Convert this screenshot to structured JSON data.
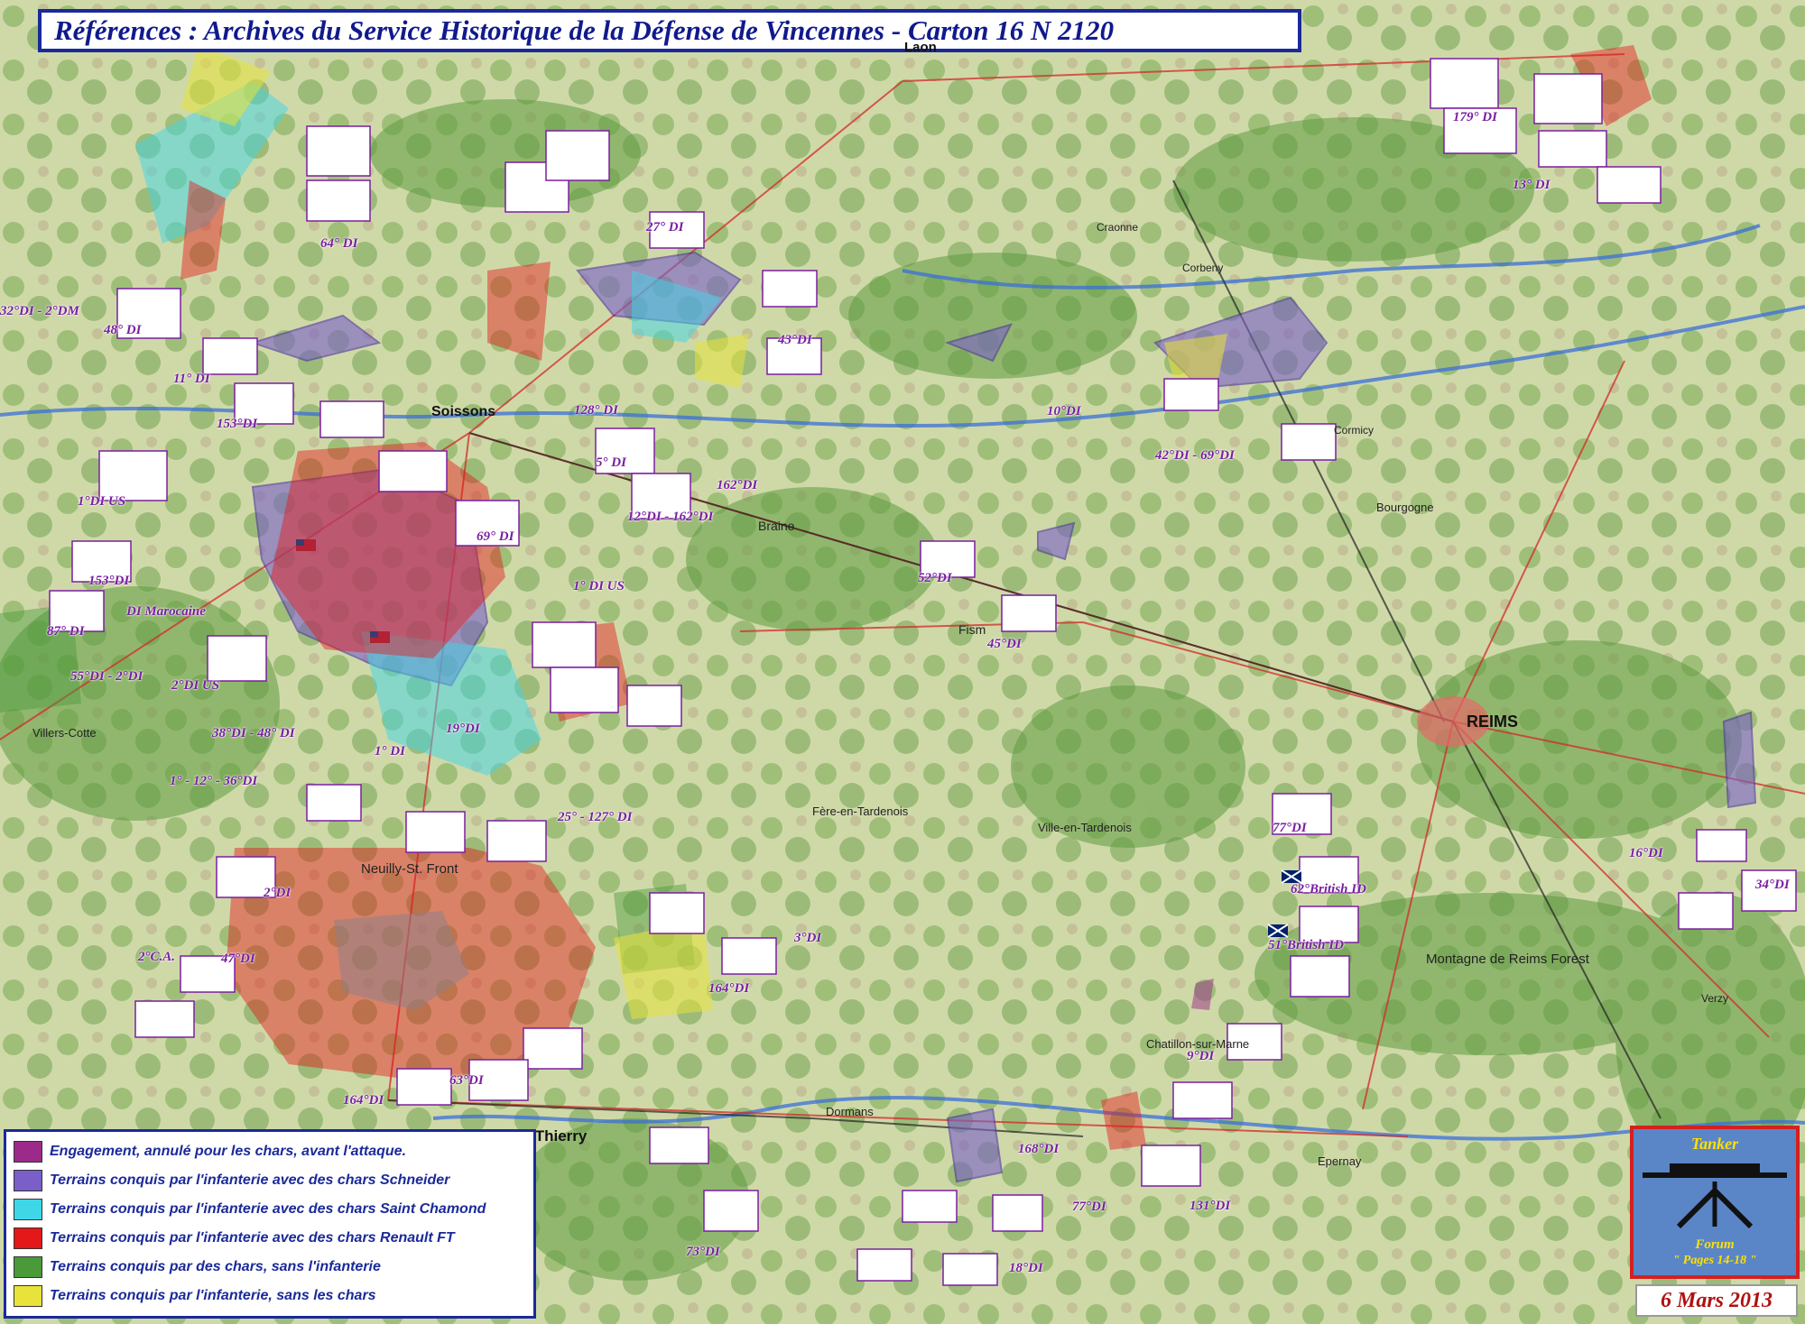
{
  "title": "Références : Archives du Service Historique de la Défense de Vincennes - Carton 16 N 2120",
  "legend": [
    {
      "color": "#9b2a8a",
      "text": "Engagement, annulé pour les chars, avant l'attaque."
    },
    {
      "color": "#7a5fc8",
      "text": "Terrains conquis par l'infanterie avec des chars Schneider"
    },
    {
      "color": "#3fd6e8",
      "text": "Terrains conquis par l'infanterie avec des chars Saint Chamond"
    },
    {
      "color": "#e41818",
      "text": "Terrains conquis par l'infanterie avec des chars Renault FT"
    },
    {
      "color": "#4a9a3a",
      "text": "Terrains conquis par des chars, sans l'infanterie"
    },
    {
      "color": "#e8e23a",
      "text": "Terrains conquis par l'infanterie, sans les chars"
    }
  ],
  "logo": {
    "title": "Tanker",
    "forum": "Forum",
    "pages": "\" Pages 14-18 \""
  },
  "date": "6 Mars 2013",
  "cities": {
    "reims": "REIMS",
    "soissons": "Soissons",
    "chateau_thierry": "Chateau-Thierry",
    "laon": "Laon"
  },
  "places": {
    "braine": "Braine",
    "fismes": "Fism",
    "epernay": "Epernay",
    "dormans": "Dormans",
    "villers_cotterets": "Villers-Cotte",
    "neuilly": "Neuilly-St. Front",
    "fere": "Fère-en-Tardenois",
    "bourgogne": "Bourgogne",
    "verzy": "Verzy",
    "montagne": "Montagne de Reims Forest",
    "ville_tardenois": "Ville-en-Tardenois",
    "chatillon": "Chatillon-sur-Marne",
    "cormicy": "Cormicy",
    "craonne": "Craonne",
    "corbeny": "Corbeny"
  },
  "units": {
    "u1": "32°DI - 2°DM",
    "u2": "48° DI",
    "u3": "64° DI",
    "u4": "11° DI",
    "u5": "153°DI",
    "u6": "1°DI US",
    "u7": "153°DI",
    "u8": "87° DI",
    "u9": "DI Marocaine",
    "u10": "55°DI - 2°DI",
    "u11": "2°DI US",
    "u12": "1° DI US",
    "u13": "69° DI",
    "u14": "5° DI",
    "u15": "128° DI",
    "u16": "12°DI - 162°DI",
    "u17": "162°DI",
    "u18": "52°DI",
    "u19": "45°DI",
    "u20": "19°DI",
    "u21": "1° DI",
    "u22": "38°DI - 48° DI",
    "u23": "1° - 12° - 36°DI",
    "u24": "25° - 127° DI",
    "u25": "2°DI",
    "u26": "47°DI",
    "u27": "2°C.A.",
    "u28": "164°DI",
    "u29": "63°DI",
    "u30": "77°DI",
    "u31": "62°British ID",
    "u32": "51°British ID",
    "u33": "9°DI",
    "u34": "16°DI",
    "u35": "34°DI",
    "u36": "10°DI",
    "u37": "42°DI - 69°DI",
    "u38": "43°DI",
    "u39": "179° DI",
    "u40": "13° DI",
    "u41": "27° DI",
    "u42": "73°DI",
    "u43": "18°DI",
    "u44": "131°DI",
    "u45": "168°DI",
    "u46": "77°DI",
    "u47": "164°DI",
    "u48": "3°DI"
  }
}
